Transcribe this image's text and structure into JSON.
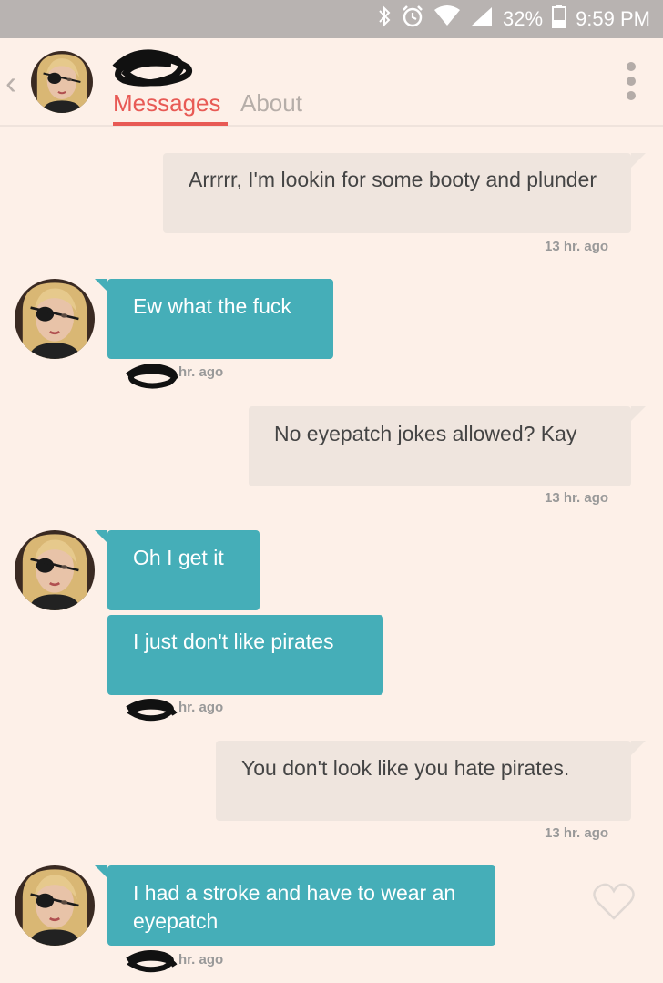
{
  "status_bar": {
    "battery": "32%",
    "time": "9:59 PM"
  },
  "header": {
    "back_icon": "‹",
    "tabs": [
      {
        "label": "Messages"
      },
      {
        "label": "About"
      }
    ]
  },
  "messages": [
    {
      "side": "out",
      "text": "Arrrrr, I'm lookin for some booty and plunder",
      "time": "13 hr. ago"
    },
    {
      "side": "in",
      "text": "Ew what the fuck",
      "time": "hr. ago"
    },
    {
      "side": "out",
      "text": "No eyepatch jokes allowed? Kay",
      "time": "13 hr. ago"
    },
    {
      "side": "in",
      "text": "Oh I get it"
    },
    {
      "side": "in",
      "text": "I just don't like pirates",
      "time": "hr. ago"
    },
    {
      "side": "out",
      "text": "You don't look like you hate pirates.",
      "time": "13 hr. ago"
    },
    {
      "side": "in",
      "text": "I had a stroke and have to wear an eyepatch",
      "time": "hr. ago"
    }
  ],
  "colors": {
    "accent": "#e85a55",
    "incoming": "#45aeb8",
    "outgoing": "#efe5de",
    "background": "#fdf0e8"
  }
}
